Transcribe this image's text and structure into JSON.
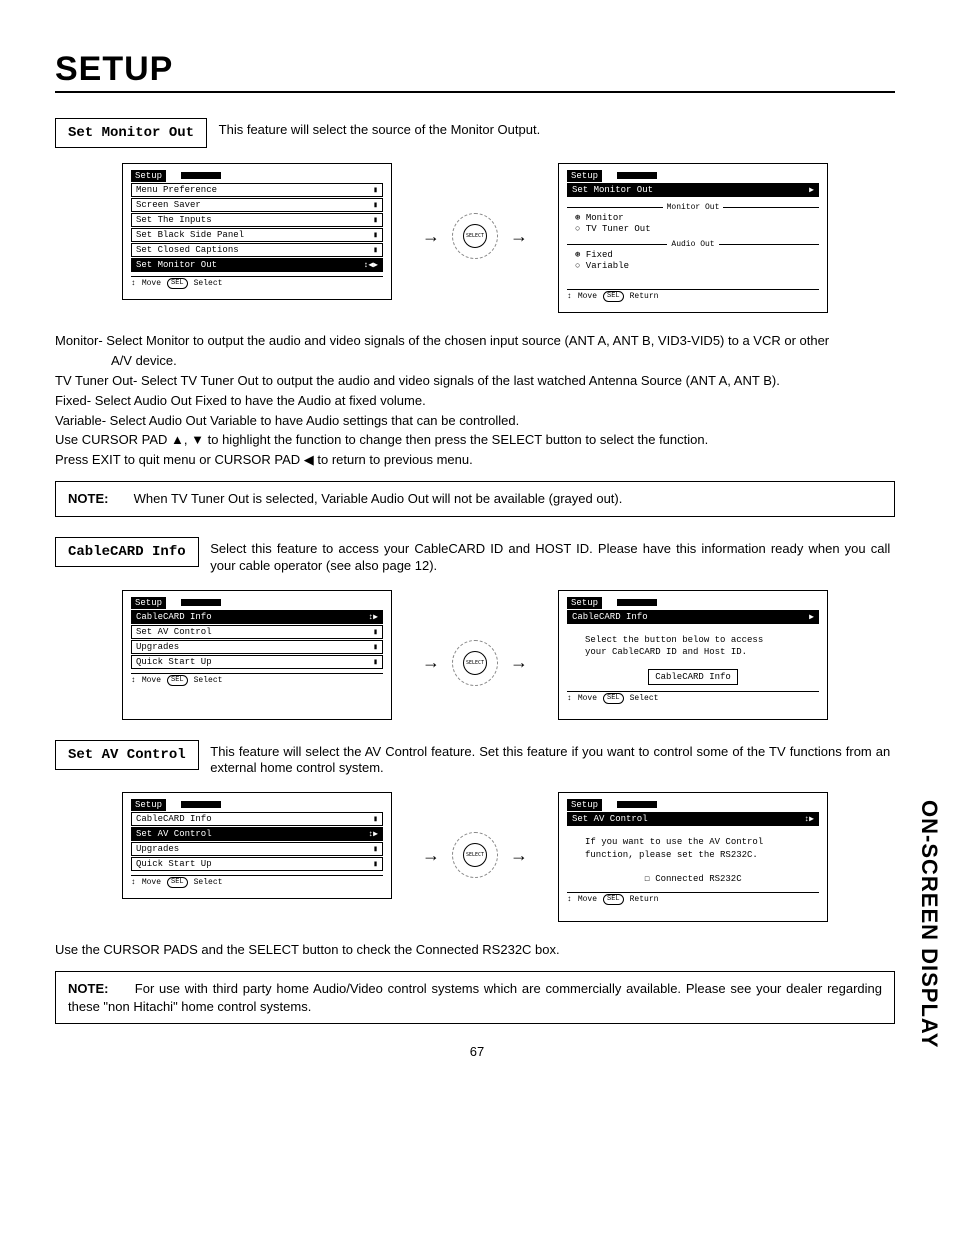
{
  "page": {
    "title": "Setup",
    "side_tab": "ON-SCREEN DISPLAY",
    "page_number": "67",
    "select_label": "SELECT",
    "sel_key": "SEL"
  },
  "section1": {
    "label": "Set Monitor Out",
    "desc": "This feature will select the source of the Monitor Output.",
    "left_menu": {
      "header": "Setup",
      "items": [
        "Menu Preference",
        "Screen Saver",
        "Set The Inputs",
        "Set Black Side Panel",
        "Set Closed Captions",
        "Set Monitor Out"
      ],
      "hl_index": 5,
      "nav_icon": "↕◀▶",
      "foot": [
        "↕",
        "Move",
        "Select"
      ]
    },
    "right_menu": {
      "header": "Setup",
      "item": "Set Monitor Out",
      "nav": "▶",
      "group1": "Monitor Out",
      "opt1a": "⊛ Monitor",
      "opt1b": "○ TV Tuner Out",
      "group2": "Audio Out",
      "opt2a": "⊛ Fixed",
      "opt2b": "○ Variable",
      "foot": [
        "↕",
        "Move",
        "Return"
      ]
    },
    "body": [
      "Monitor- Select Monitor to output the audio and video signals of the chosen input source (ANT A, ANT B, VID3-VID5) to a VCR or other",
      "A/V device.",
      "TV Tuner Out- Select TV Tuner Out to output the audio and video signals of the last watched Antenna Source (ANT A, ANT B).",
      "Fixed-  Select Audio Out Fixed to have the Audio at fixed volume.",
      "Variable- Select Audio Out Variable to have Audio settings that can be controlled.",
      "Use CURSOR PAD ▲, ▼ to highlight the function to change then press the SELECT button to select the function.",
      "Press EXIT to quit menu or CURSOR PAD ◀ to return to previous menu."
    ],
    "note_label": "NOTE:",
    "note": "When TV Tuner Out is selected, Variable Audio Out will not be available (grayed out)."
  },
  "section2": {
    "label": "CableCARD Info",
    "desc": "Select this feature to access your CableCARD ID and HOST ID.  Please have this information ready when you call your cable operator (see also page 12).",
    "left_menu": {
      "header": "Setup",
      "items": [
        "CableCARD Info",
        "Set AV Control",
        "Upgrades",
        "Quick Start Up"
      ],
      "hl_index": 0,
      "nav_icon": "↕▶",
      "foot": [
        "↕",
        "Move",
        "Select"
      ]
    },
    "right_menu": {
      "header": "Setup",
      "item": "CableCARD Info",
      "nav": "▶",
      "instr1": "Select the button below to access",
      "instr2": "your CableCARD ID and Host ID.",
      "button": "CableCARD Info",
      "foot": [
        "↕",
        "Move",
        "Select"
      ]
    }
  },
  "section3": {
    "label": "Set AV Control",
    "desc": "This feature will select the AV Control feature.  Set this feature if you want to control some of the TV functions from an external home control system.",
    "left_menu": {
      "header": "Setup",
      "items": [
        "CableCARD Info",
        "Set AV Control",
        "Upgrades",
        "Quick Start Up"
      ],
      "hl_index": 1,
      "nav_icon": "↕▶",
      "foot": [
        "↕",
        "Move",
        "Select"
      ]
    },
    "right_menu": {
      "header": "Setup",
      "item": "Set AV Control",
      "nav": "↕▶",
      "instr1": "If you want to use the AV Control",
      "instr2": "function, please set the RS232C.",
      "checkbox": "☐ Connected RS232C",
      "foot": [
        "↕",
        "Move",
        "Return"
      ]
    },
    "body_after": "Use the CURSOR PADS and the SELECT button to check the Connected RS232C box.",
    "note_label": "NOTE:",
    "note": "For use with third party home Audio/Video control systems which are commercially available.  Please see your dealer regarding these \"non Hitachi\" home control systems."
  }
}
